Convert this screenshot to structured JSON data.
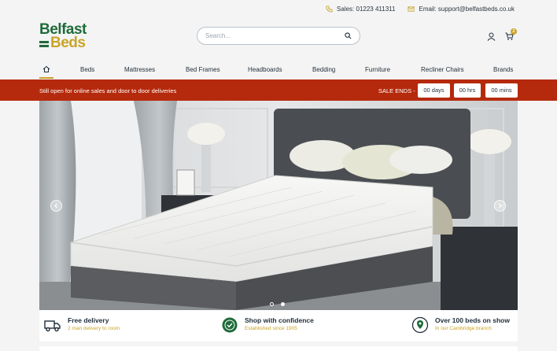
{
  "contact": {
    "sales_label": "Sales: 01223 411311",
    "email_label": "Email: support@belfastbeds.co.uk"
  },
  "logo": {
    "line1": "Belfast",
    "line2": "Beds"
  },
  "search": {
    "placeholder": "Search..."
  },
  "cart": {
    "count": "2"
  },
  "nav": {
    "items": [
      "Beds",
      "Mattresses",
      "Bed Frames",
      "Headboards",
      "Bedding",
      "Furniture",
      "Recliner Chairs",
      "Brands"
    ]
  },
  "sale_bar": {
    "message": "Still open for online sales and door to door deliveries",
    "ends_label": "SALE ENDS -",
    "days": "00 days",
    "hrs": "00 hrs",
    "mins": "00 mins"
  },
  "features": [
    {
      "title": "Free delivery",
      "subtitle": "2 man delivery to room",
      "icon": "truck-icon"
    },
    {
      "title": "Shop with confidence",
      "subtitle": "Established since 1905",
      "icon": "badge-check-icon"
    },
    {
      "title": "Over 100 beds on show",
      "subtitle": "In our Cambridge branch",
      "icon": "map-pin-icon"
    }
  ],
  "colors": {
    "brand_green": "#1f6b3a",
    "brand_gold": "#c9a428",
    "sale_red": "#b52a0c"
  }
}
